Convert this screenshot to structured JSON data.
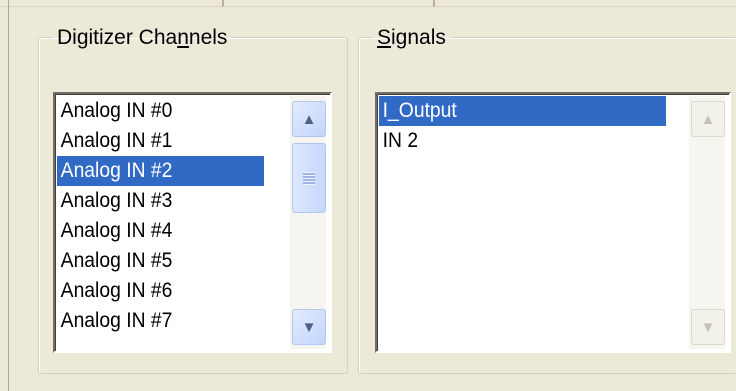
{
  "digitizer": {
    "legend_pre": "Digitizer Cha",
    "legend_accel": "n",
    "legend_post": "nels",
    "items": [
      "Analog IN #0",
      "Analog IN #1",
      "Analog IN #2",
      "Analog IN #3",
      "Analog IN #4",
      "Analog IN #5",
      "Analog IN #6",
      "Analog IN #7"
    ],
    "selected": "Analog IN #2"
  },
  "signals": {
    "legend_accel": "S",
    "legend_post": "ignals",
    "items": [
      "I_Output",
      "IN 2"
    ],
    "selected": "I_Output"
  },
  "icons": {
    "scroll_up": "chevron-up-icon",
    "scroll_down": "chevron-down-icon",
    "thumb_grip": "grip-icon"
  },
  "colors": {
    "selection": "#316ac5",
    "dialog_bg": "#ece9d8"
  }
}
